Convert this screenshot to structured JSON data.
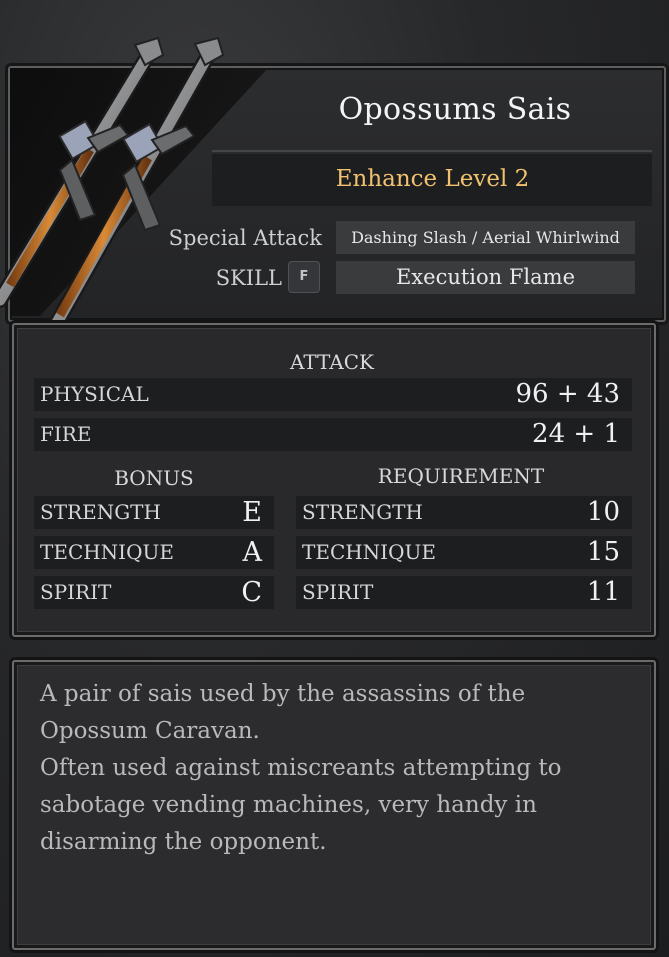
{
  "item": {
    "name": "Opossums Sais",
    "enhance_level": "Enhance Level 2",
    "special_attack_label": "Special Attack",
    "special_attack_value": "Dashing Slash / Aerial Whirlwind",
    "skill_label": "SKILL",
    "skill_key": "F",
    "skill_value": "Execution Flame",
    "weapon_icon": "twin-sais-icon"
  },
  "stats": {
    "attack_header": "ATTACK",
    "attack_rows": [
      {
        "label": "PHYSICAL",
        "value": "96 + 43"
      },
      {
        "label": "FIRE",
        "value": "24 + 1"
      }
    ],
    "bonus_header": "BONUS",
    "bonus_rows": [
      {
        "label": "STRENGTH",
        "grade": "E"
      },
      {
        "label": "TECHNIQUE",
        "grade": "A"
      },
      {
        "label": "SPIRIT",
        "grade": "C"
      }
    ],
    "requirement_header": "REQUIREMENT",
    "requirement_rows": [
      {
        "label": "STRENGTH",
        "value": "10"
      },
      {
        "label": "TECHNIQUE",
        "value": "15"
      },
      {
        "label": "SPIRIT",
        "value": "11"
      }
    ]
  },
  "description": {
    "line1": "A pair of sais used by the assassins of the Opossum Caravan.",
    "line2": "Often used against miscreants attempting to sabotage vending machines, very handy in disarming the opponent."
  },
  "colors": {
    "enhance_text": "#f1c170",
    "panel_bg": "#29292b",
    "row_bg": "#1d1e20",
    "value_box_bg": "#3a3b3d"
  }
}
